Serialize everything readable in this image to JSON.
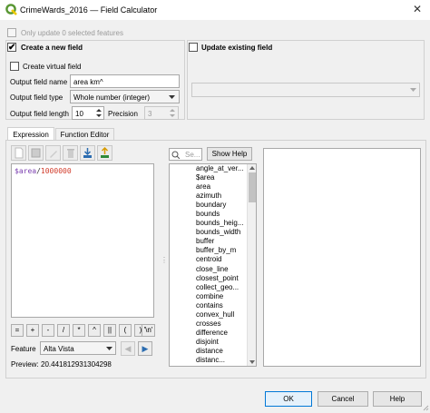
{
  "window": {
    "title": "CrimeWards_2016 — Field Calculator",
    "close_glyph": "✕"
  },
  "top": {
    "only_update_label": "Only update 0 selected features"
  },
  "create_group": {
    "title": "Create a new field",
    "checked_glyph": "✔",
    "virtual_label": "Create virtual field",
    "name_label": "Output field name",
    "name_value": "area km^",
    "type_label": "Output field type",
    "type_value": "Whole number (integer)",
    "length_label": "Output field length",
    "length_value": "10",
    "precision_label": "Precision",
    "precision_value": "3"
  },
  "update_group": {
    "title": "Update existing field"
  },
  "tabs": {
    "expression": "Expression",
    "function_editor": "Function Editor"
  },
  "expression": {
    "text_field": "$area",
    "text_op": "/",
    "text_num": "1000000"
  },
  "operators": [
    "=",
    "+",
    "-",
    "/",
    "*",
    "^",
    "||",
    "(",
    ")",
    "'\\n'"
  ],
  "feature": {
    "label": "Feature",
    "value": "Alta Vista",
    "prev_glyph": "◀",
    "next_glyph": "▶"
  },
  "preview": {
    "label": "Preview:",
    "value": "20.441812931304298"
  },
  "search": {
    "placeholder": "Se...",
    "show_help": "Show Help"
  },
  "functions": [
    "angle_at_ver...",
    "$area",
    "area",
    "azimuth",
    "boundary",
    "bounds",
    "bounds_heig...",
    "bounds_width",
    "buffer",
    "buffer_by_m",
    "centroid",
    "close_line",
    "closest_point",
    "collect_geo...",
    "combine",
    "contains",
    "convex_hull",
    "crosses",
    "difference",
    "disjoint",
    "distance",
    "distanc..."
  ],
  "buttons": {
    "ok": "OK",
    "cancel": "Cancel",
    "help": "Help"
  },
  "colors": {
    "field": "#7b3fb0",
    "number": "#d13b2a",
    "accent": "#0078d7",
    "qgis_green": "#589632",
    "qgis_yellow": "#eec900"
  }
}
